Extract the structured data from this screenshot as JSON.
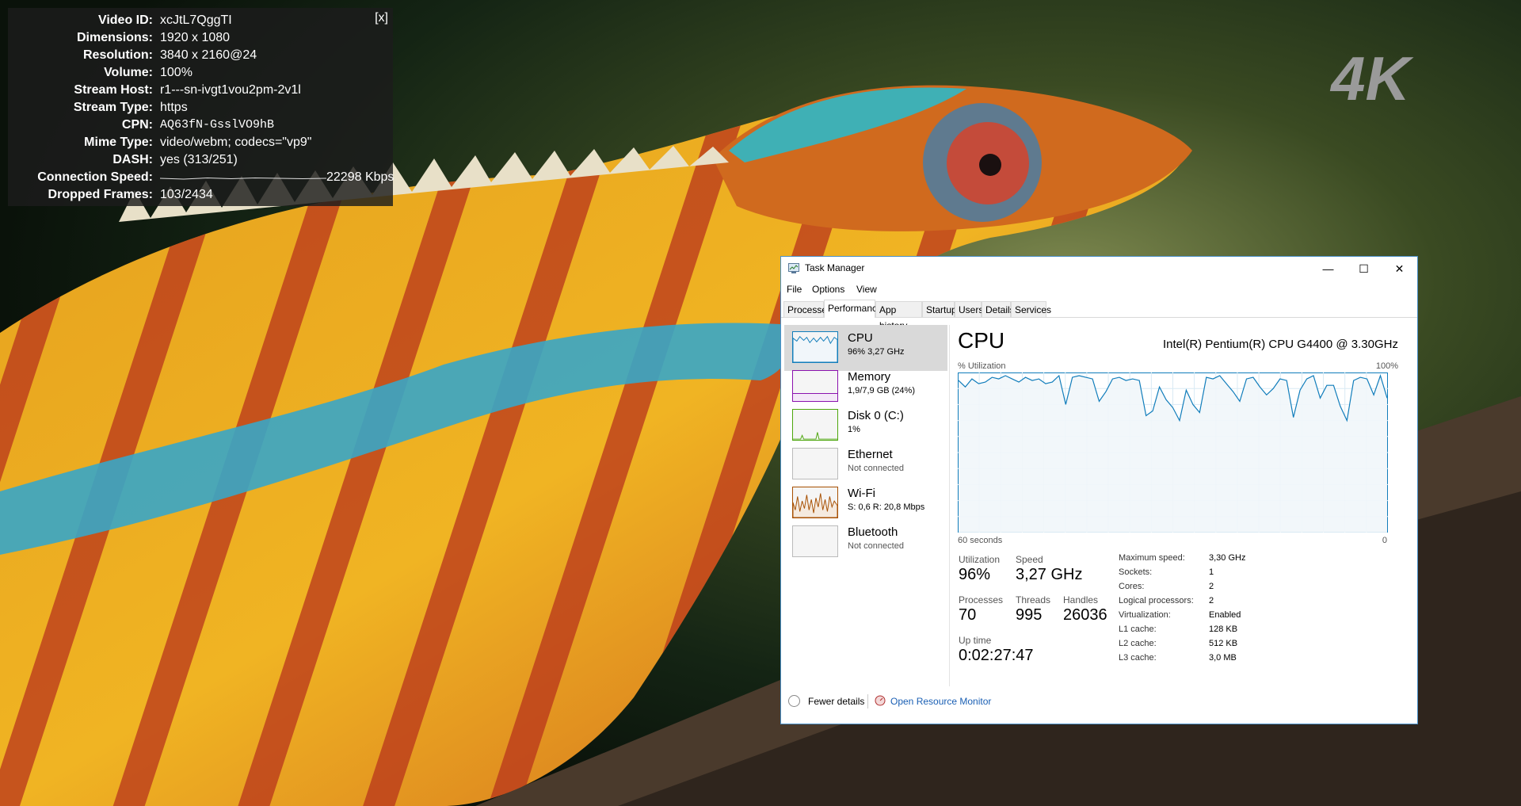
{
  "stats_overlay": {
    "close_label": "[x]",
    "rows": [
      {
        "key": "Video ID:",
        "value": "xcJtL7QggTI"
      },
      {
        "key": "Dimensions:",
        "value": "1920 x 1080"
      },
      {
        "key": "Resolution:",
        "value": "3840 x 2160@24"
      },
      {
        "key": "Volume:",
        "value": "100%"
      },
      {
        "key": "Stream Host:",
        "value": "r1---sn-ivgt1vou2pm-2v1l"
      },
      {
        "key": "Stream Type:",
        "value": "https"
      },
      {
        "key": "CPN:",
        "value": "AQ63fN-GsslVO9hB"
      },
      {
        "key": "Mime Type:",
        "value": "video/webm; codecs=\"vp9\""
      },
      {
        "key": "DASH:",
        "value": "yes (313/251)"
      },
      {
        "key": "Connection Speed:",
        "value": "22298 Kbps"
      },
      {
        "key": "Dropped Frames:",
        "value": "103/2434"
      }
    ]
  },
  "logo": {
    "text": "4K",
    "color": "#9a9a9a"
  },
  "task_manager": {
    "title": "Task Manager",
    "window_buttons": {
      "minimize": "—",
      "maximize": "☐",
      "close": "✕"
    },
    "menu": [
      "File",
      "Options",
      "View"
    ],
    "tabs": [
      "Processes",
      "Performance",
      "App history",
      "Startup",
      "Users",
      "Details",
      "Services"
    ],
    "active_tab": "Performance",
    "side_items": [
      {
        "name": "CPU",
        "sub": "96% 3,27 GHz",
        "color": "#117dbb"
      },
      {
        "name": "Memory",
        "sub": "1,9/7,9 GB (24%)",
        "color": "#8b12ae"
      },
      {
        "name": "Disk 0 (C:)",
        "sub": "1%",
        "color": "#4da60c"
      },
      {
        "name": "Ethernet",
        "sub": "Not connected",
        "color": "#a74f01"
      },
      {
        "name": "Wi-Fi",
        "sub": "S: 0,6 R: 20,8 Mbps",
        "color": "#a74f01"
      },
      {
        "name": "Bluetooth",
        "sub": "Not connected",
        "color": "#a74f01"
      }
    ],
    "cpu_panel": {
      "heading": "CPU",
      "cpu_name": "Intel(R) Pentium(R) CPU G4400 @ 3.30GHz",
      "util_label": "% Utilization",
      "max_label": "100%",
      "time_label": "60 seconds",
      "min_label": "0",
      "utilization_label": "Utilization",
      "utilization": "96%",
      "speed_label": "Speed",
      "speed": "3,27 GHz",
      "processes_label": "Processes",
      "processes": "70",
      "threads_label": "Threads",
      "threads": "995",
      "handles_label": "Handles",
      "handles": "26036",
      "uptime_label": "Up time",
      "uptime": "0:02:27:47",
      "specs": [
        {
          "key": "Maximum speed:",
          "value": "3,30 GHz"
        },
        {
          "key": "Sockets:",
          "value": "1"
        },
        {
          "key": "Cores:",
          "value": "2"
        },
        {
          "key": "Logical processors:",
          "value": "2"
        },
        {
          "key": "Virtualization:",
          "value": "Enabled"
        },
        {
          "key": "L1 cache:",
          "value": "128 KB"
        },
        {
          "key": "L2 cache:",
          "value": "512 KB"
        },
        {
          "key": "L3 cache:",
          "value": "3,0 MB"
        }
      ],
      "history_percent": [
        95,
        91,
        96,
        93,
        94,
        97,
        96,
        98,
        96,
        94,
        97,
        95,
        96,
        93,
        94,
        98,
        80,
        97,
        98,
        97,
        96,
        82,
        88,
        96,
        97,
        95,
        96,
        95,
        73,
        76,
        91,
        83,
        78,
        70,
        89,
        80,
        75,
        97,
        96,
        98,
        93,
        88,
        82,
        96,
        97,
        91,
        86,
        90,
        96,
        95,
        72,
        89,
        96,
        98,
        84,
        92,
        92,
        79,
        70,
        95,
        97,
        96,
        86,
        98,
        84
      ]
    },
    "footer": {
      "fewer": "Fewer details",
      "resource_monitor": "Open Resource Monitor"
    }
  }
}
